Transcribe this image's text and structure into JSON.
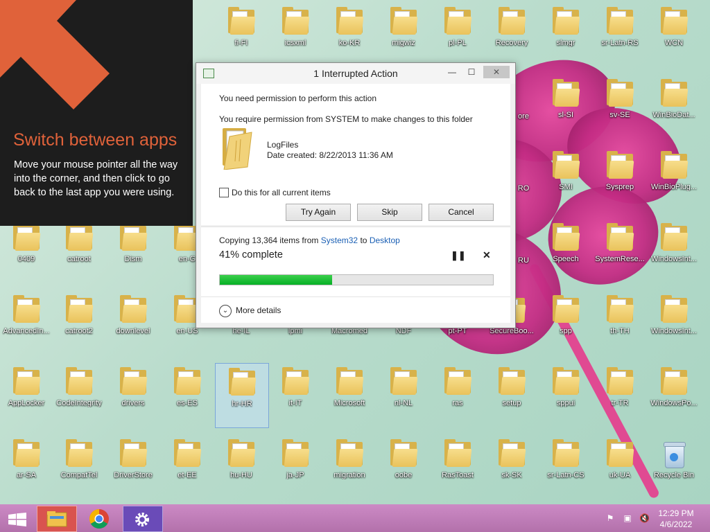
{
  "tip": {
    "title": "Switch between apps",
    "body": "Move your mouse pointer all the way into the corner, and then click to go back to the last app you were using."
  },
  "dialog": {
    "title": "1 Interrupted Action",
    "permission_heading": "You need permission to perform this action",
    "permission_detail": "You require permission from SYSTEM to make changes to this folder",
    "item_name": "LogFiles",
    "item_date": "Date created: 8/22/2013 11:36 AM",
    "checkbox_label": "Do this for all current items",
    "buttons": {
      "try_again": "Try Again",
      "skip": "Skip",
      "cancel": "Cancel"
    },
    "copy_prefix": "Copying 13,364 items from",
    "source": "System32",
    "to_word": "to",
    "destination": "Desktop",
    "percent_text": "41% complete",
    "progress_fraction": 0.41,
    "more_details": "More details",
    "window_buttons": {
      "minimize": "—",
      "maximize": "☐",
      "close": "✕"
    }
  },
  "desktop_icons": [
    [
      "",
      "fi-FI",
      "icsxml",
      "ko-KR",
      "migwiz",
      "pl-PL",
      "Recovery",
      "slmgr",
      "sr-Latn-RS",
      "WCN"
    ],
    [
      "",
      "",
      "",
      "",
      "",
      "",
      "",
      "sl-SI",
      "sv-SE",
      "WinBioDat..."
    ],
    [
      "",
      "",
      "",
      "",
      "",
      "",
      "",
      "SMI",
      "Sysprep",
      "WinBioPlug..."
    ],
    [
      "0409",
      "catroot",
      "Dism",
      "en-G",
      "",
      "",
      "",
      "Speech",
      "SystemRese...",
      "WindowsInt..."
    ],
    [
      "AdvancedIn...",
      "catroot2",
      "downlevel",
      "en-US",
      "he-IL",
      "lpmi",
      "Macromed",
      "NDF",
      "pt-PT",
      "SecureBoo...",
      "spp",
      "th-TH",
      "WindowsInt..."
    ],
    [
      "AppLocker",
      "CodeIntegrity",
      "drivers",
      "es-ES",
      "hr-HR",
      "it-IT",
      "Microsoft",
      "nl-NL",
      "ras",
      "setup",
      "sppui",
      "tr-TR",
      "WindowsPo..."
    ],
    [
      "ar-SA",
      "CompatTel",
      "DriverStore",
      "et-EE",
      "hu-HU",
      "ja-JP",
      "migration",
      "oobe",
      "RasToast",
      "sk-SK",
      "sr-Latn-CS",
      "uk-UA",
      "Recycle Bin"
    ]
  ],
  "partial_labels": {
    "ore": "ore",
    "ro": "RO",
    "ru": "RU"
  },
  "taskbar": {
    "time": "12:29 PM",
    "date": "4/6/2022"
  }
}
